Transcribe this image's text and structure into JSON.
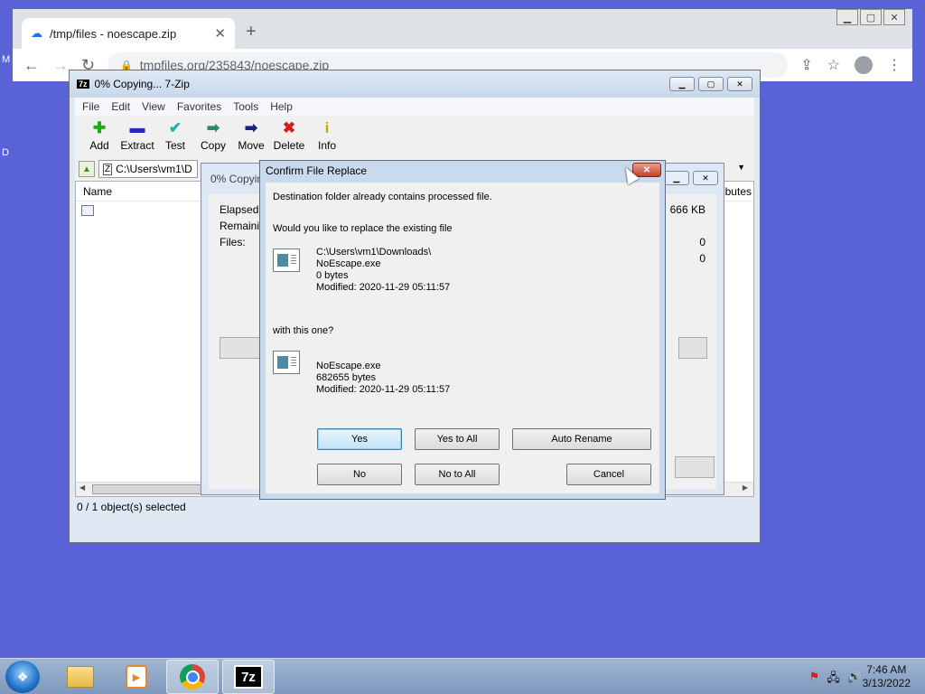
{
  "browser": {
    "tab_title": "/tmp/files - noescape.zip",
    "tab_close": "✕",
    "new_tab": "+",
    "url_host": "tmpfiles.org",
    "url_path": "/235843/noescape.zip",
    "desktop_left_top": "M",
    "desktop_left_mid": "D"
  },
  "zip": {
    "title": "0% Copying... 7-Zip",
    "logo": "7z",
    "menu": [
      "File",
      "Edit",
      "View",
      "Favorites",
      "Tools",
      "Help"
    ],
    "toolbar": [
      {
        "label": "Add",
        "icon": "✚",
        "color": "#1ea81e"
      },
      {
        "label": "Extract",
        "icon": "▬",
        "color": "#2a2ab8"
      },
      {
        "label": "Test",
        "icon": "✔",
        "color": "#22b0b8"
      },
      {
        "label": "Copy",
        "icon": "➡",
        "color": "#2a8a6a"
      },
      {
        "label": "Move",
        "icon": "➡",
        "color": "#1a237e"
      },
      {
        "label": "Delete",
        "icon": "✖",
        "color": "#d81b1b"
      },
      {
        "label": "Info",
        "icon": "i",
        "color": "#c9a800"
      }
    ],
    "path": "C:\\Users\\vm1\\D",
    "list_header_name": "Name",
    "list_header_attr": "ributes",
    "status": "0 / 1 object(s) selected",
    "hscroll_thumb": "III"
  },
  "progress": {
    "title": "0% Copying",
    "elapsed_label": "Elapsed ti",
    "remaining_label": "Remaining",
    "files_label": "Files:",
    "size_value": "666 KB",
    "files_value": "0",
    "second_value": "0"
  },
  "confirm": {
    "title": "Confirm File Replace",
    "close": "✕",
    "line1": "Destination folder already contains processed file.",
    "line2": "Would you like to replace the existing file",
    "existing": {
      "path": "C:\\Users\\vm1\\Downloads\\",
      "name": "NoEscape.exe",
      "size": "0 bytes",
      "modified": "Modified: 2020-11-29 05:11:57"
    },
    "with_this": "with this one?",
    "incoming": {
      "name": "NoEscape.exe",
      "size": "682655 bytes",
      "modified": "Modified: 2020-11-29 05:11:57"
    },
    "buttons": {
      "yes": "Yes",
      "yes_to_all": "Yes to All",
      "auto_rename": "Auto Rename",
      "no": "No",
      "no_to_all": "No to All",
      "cancel": "Cancel"
    }
  },
  "taskbar": {
    "time": "7:46 AM",
    "date": "3/13/2022",
    "sevenz_label": "7z"
  }
}
